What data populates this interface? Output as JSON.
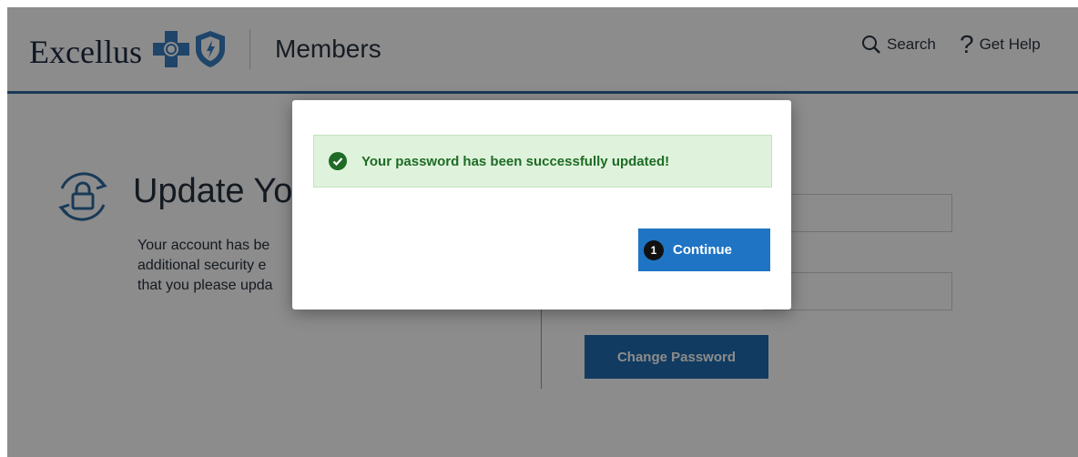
{
  "header": {
    "logo_text": "Excellus",
    "section_title": "Members",
    "search_label": "Search",
    "help_label": "Get Help",
    "help_symbol": "?"
  },
  "background": {
    "title": "Update You",
    "description_lines": [
      "Your account has be",
      "additional security e",
      "that you please upda"
    ],
    "change_password_label": "Change Password"
  },
  "modal": {
    "alert_message": "Your password has been successfully updated!",
    "continue_label": "Continue",
    "step_badge": "1"
  },
  "colors": {
    "brand_blue": "#2f6a9f",
    "button_blue": "#1f74c4",
    "success_bg": "#dff3dc",
    "success_text": "#1e6b25"
  },
  "icons": [
    "blue-cross-icon",
    "blue-shield-icon",
    "search-icon",
    "lock-refresh-icon",
    "check-circle-icon"
  ]
}
